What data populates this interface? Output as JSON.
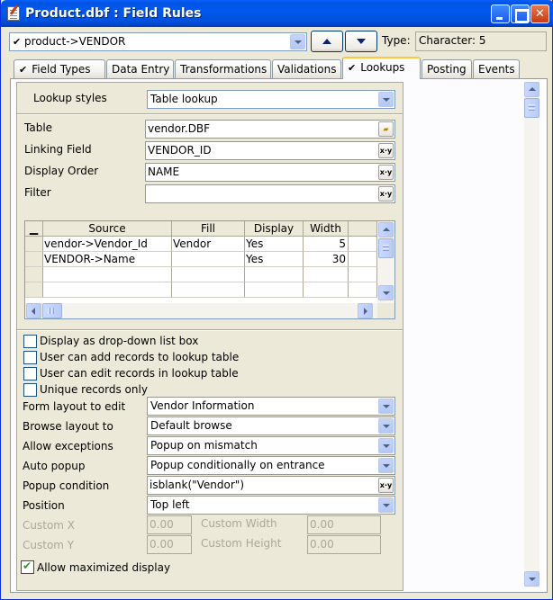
{
  "window": {
    "title": "Product.dbf : Field Rules"
  },
  "field_selector": {
    "value": "product->VENDOR"
  },
  "type": {
    "label": "Type:",
    "value": "Character: 5"
  },
  "tabs": [
    {
      "label": "Field Types",
      "checked": true
    },
    {
      "label": "Data Entry",
      "checked": false
    },
    {
      "label": "Transformations",
      "checked": false
    },
    {
      "label": "Validations",
      "checked": false
    },
    {
      "label": "Lookups",
      "checked": true,
      "active": true
    },
    {
      "label": "Posting",
      "checked": false
    },
    {
      "label": "Events",
      "checked": false
    }
  ],
  "lookup_styles": {
    "label": "Lookup styles",
    "value": "Table lookup"
  },
  "table": {
    "label": "Table",
    "value": "vendor.DBF"
  },
  "linking_field": {
    "label": "Linking Field",
    "value": "VENDOR_ID"
  },
  "display_order": {
    "label": "Display Order",
    "value": "NAME"
  },
  "filter": {
    "label": "Filter",
    "value": ""
  },
  "grid": {
    "headers": [
      "Source",
      "Fill",
      "Display",
      "Width"
    ],
    "rows": [
      {
        "source": "vendor->Vendor_Id",
        "fill": "Vendor",
        "display": "Yes",
        "width": "5"
      },
      {
        "source": "VENDOR->Name",
        "fill": "",
        "display": "Yes",
        "width": "30"
      }
    ]
  },
  "options": {
    "dropdown": "Display as drop-down list box",
    "can_add": "User can add records to lookup table",
    "can_edit": "User can edit records in lookup table",
    "unique_only": "Unique records only"
  },
  "form_layout": {
    "label": "Form layout to edit",
    "value": "Vendor Information"
  },
  "browse_layout": {
    "label": "Browse layout to",
    "value": "Default browse"
  },
  "allow_exceptions": {
    "label": "Allow exceptions",
    "value": "Popup on mismatch"
  },
  "auto_popup": {
    "label": "Auto popup",
    "value": "Popup conditionally on entrance"
  },
  "popup_condition": {
    "label": "Popup condition",
    "value": "isblank(\"Vendor\")"
  },
  "position": {
    "label": "Position",
    "value": "Top left"
  },
  "custom": {
    "x_label": "Custom X",
    "x_value": "0.00",
    "y_label": "Custom Y",
    "y_value": "0.00",
    "width_label": "Custom Width",
    "width_value": "0.00",
    "height_label": "Custom Height",
    "height_value": "0.00"
  },
  "allow_maximized": {
    "label": "Allow maximized display",
    "checked": true
  },
  "icons": {
    "expression_builder": "x·y",
    "folder": "folder-open-icon"
  },
  "colors": {
    "title_bar": "#0054e3",
    "window_bg": "#ece9d8",
    "active_tab_accent": "#ffc83c"
  }
}
